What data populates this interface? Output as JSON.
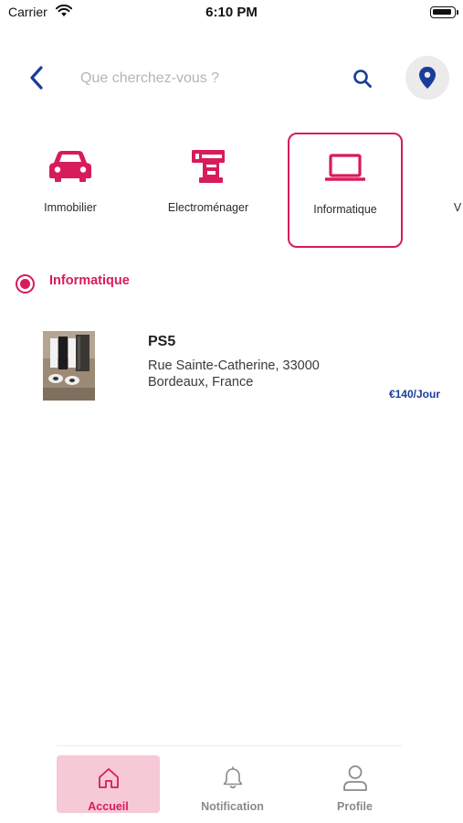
{
  "status_bar": {
    "carrier": "Carrier",
    "time": "6:10 PM"
  },
  "search": {
    "placeholder": "Que cherchez-vous ?",
    "value": ""
  },
  "categories": [
    {
      "label": "Immobilier",
      "icon": "car-icon",
      "selected": false
    },
    {
      "label": "Electroménager",
      "icon": "appliance-icon",
      "selected": false
    },
    {
      "label": "Informatique",
      "icon": "laptop-icon",
      "selected": true
    },
    {
      "label": "V",
      "icon": "",
      "selected": false
    }
  ],
  "section": {
    "title": "Informatique"
  },
  "listings": [
    {
      "title": "PS5",
      "address": "Rue Sainte-Catherine, 33000 Bordeaux, France",
      "price": "€140/Jour"
    }
  ],
  "bottom_nav": [
    {
      "label": "Accueil",
      "icon": "home-icon",
      "active": true
    },
    {
      "label": "Notification",
      "icon": "bell-icon",
      "active": false
    },
    {
      "label": "Profile",
      "icon": "user-icon",
      "active": false
    }
  ],
  "colors": {
    "accent": "#d81b5a",
    "primary_blue": "#1a3d9a",
    "nav_active_bg": "#f6c9d7"
  }
}
